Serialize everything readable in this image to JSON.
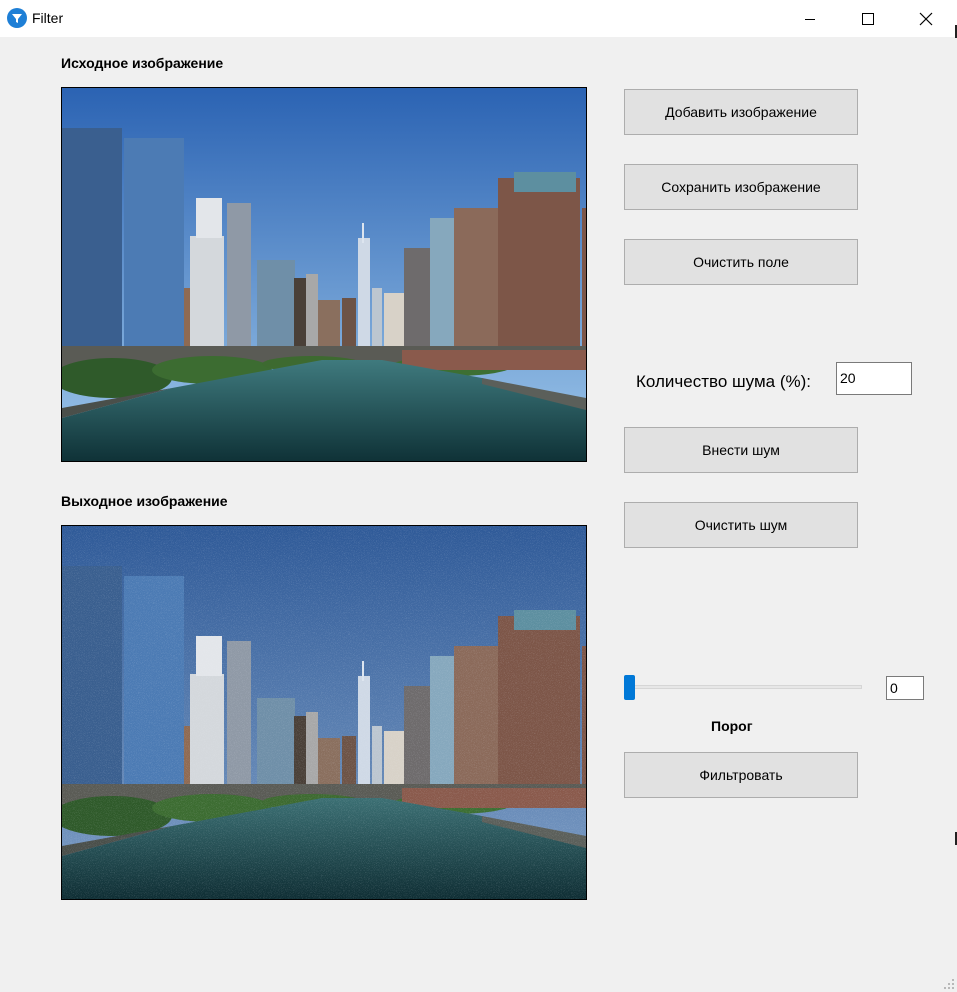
{
  "window": {
    "title": "Filter",
    "minimize_glyph": "—",
    "close_glyph": "✕"
  },
  "source_section": {
    "label": "Исходное изображение"
  },
  "output_section": {
    "label": "Выходное изображение"
  },
  "buttons": {
    "add_image": "Добавить изображение",
    "save_image": "Сохранить изображение",
    "clear_field": "Очистить поле",
    "add_noise": "Внести шум",
    "clear_noise": "Очистить шум",
    "filter": "Фильтровать"
  },
  "noise": {
    "label": "Количество шума (%):",
    "value": "20"
  },
  "threshold": {
    "label": "Порог",
    "value": "0",
    "slider_value": 0
  },
  "icons": {
    "app": "filter-funnel-icon",
    "minimize": "minimize-icon",
    "maximize": "maximize-icon",
    "close": "close-icon"
  },
  "colors": {
    "accent": "#0078d7",
    "sky_top": "#2b63b3",
    "sky_bottom": "#9ec7ea",
    "water": "#1d4b50"
  }
}
